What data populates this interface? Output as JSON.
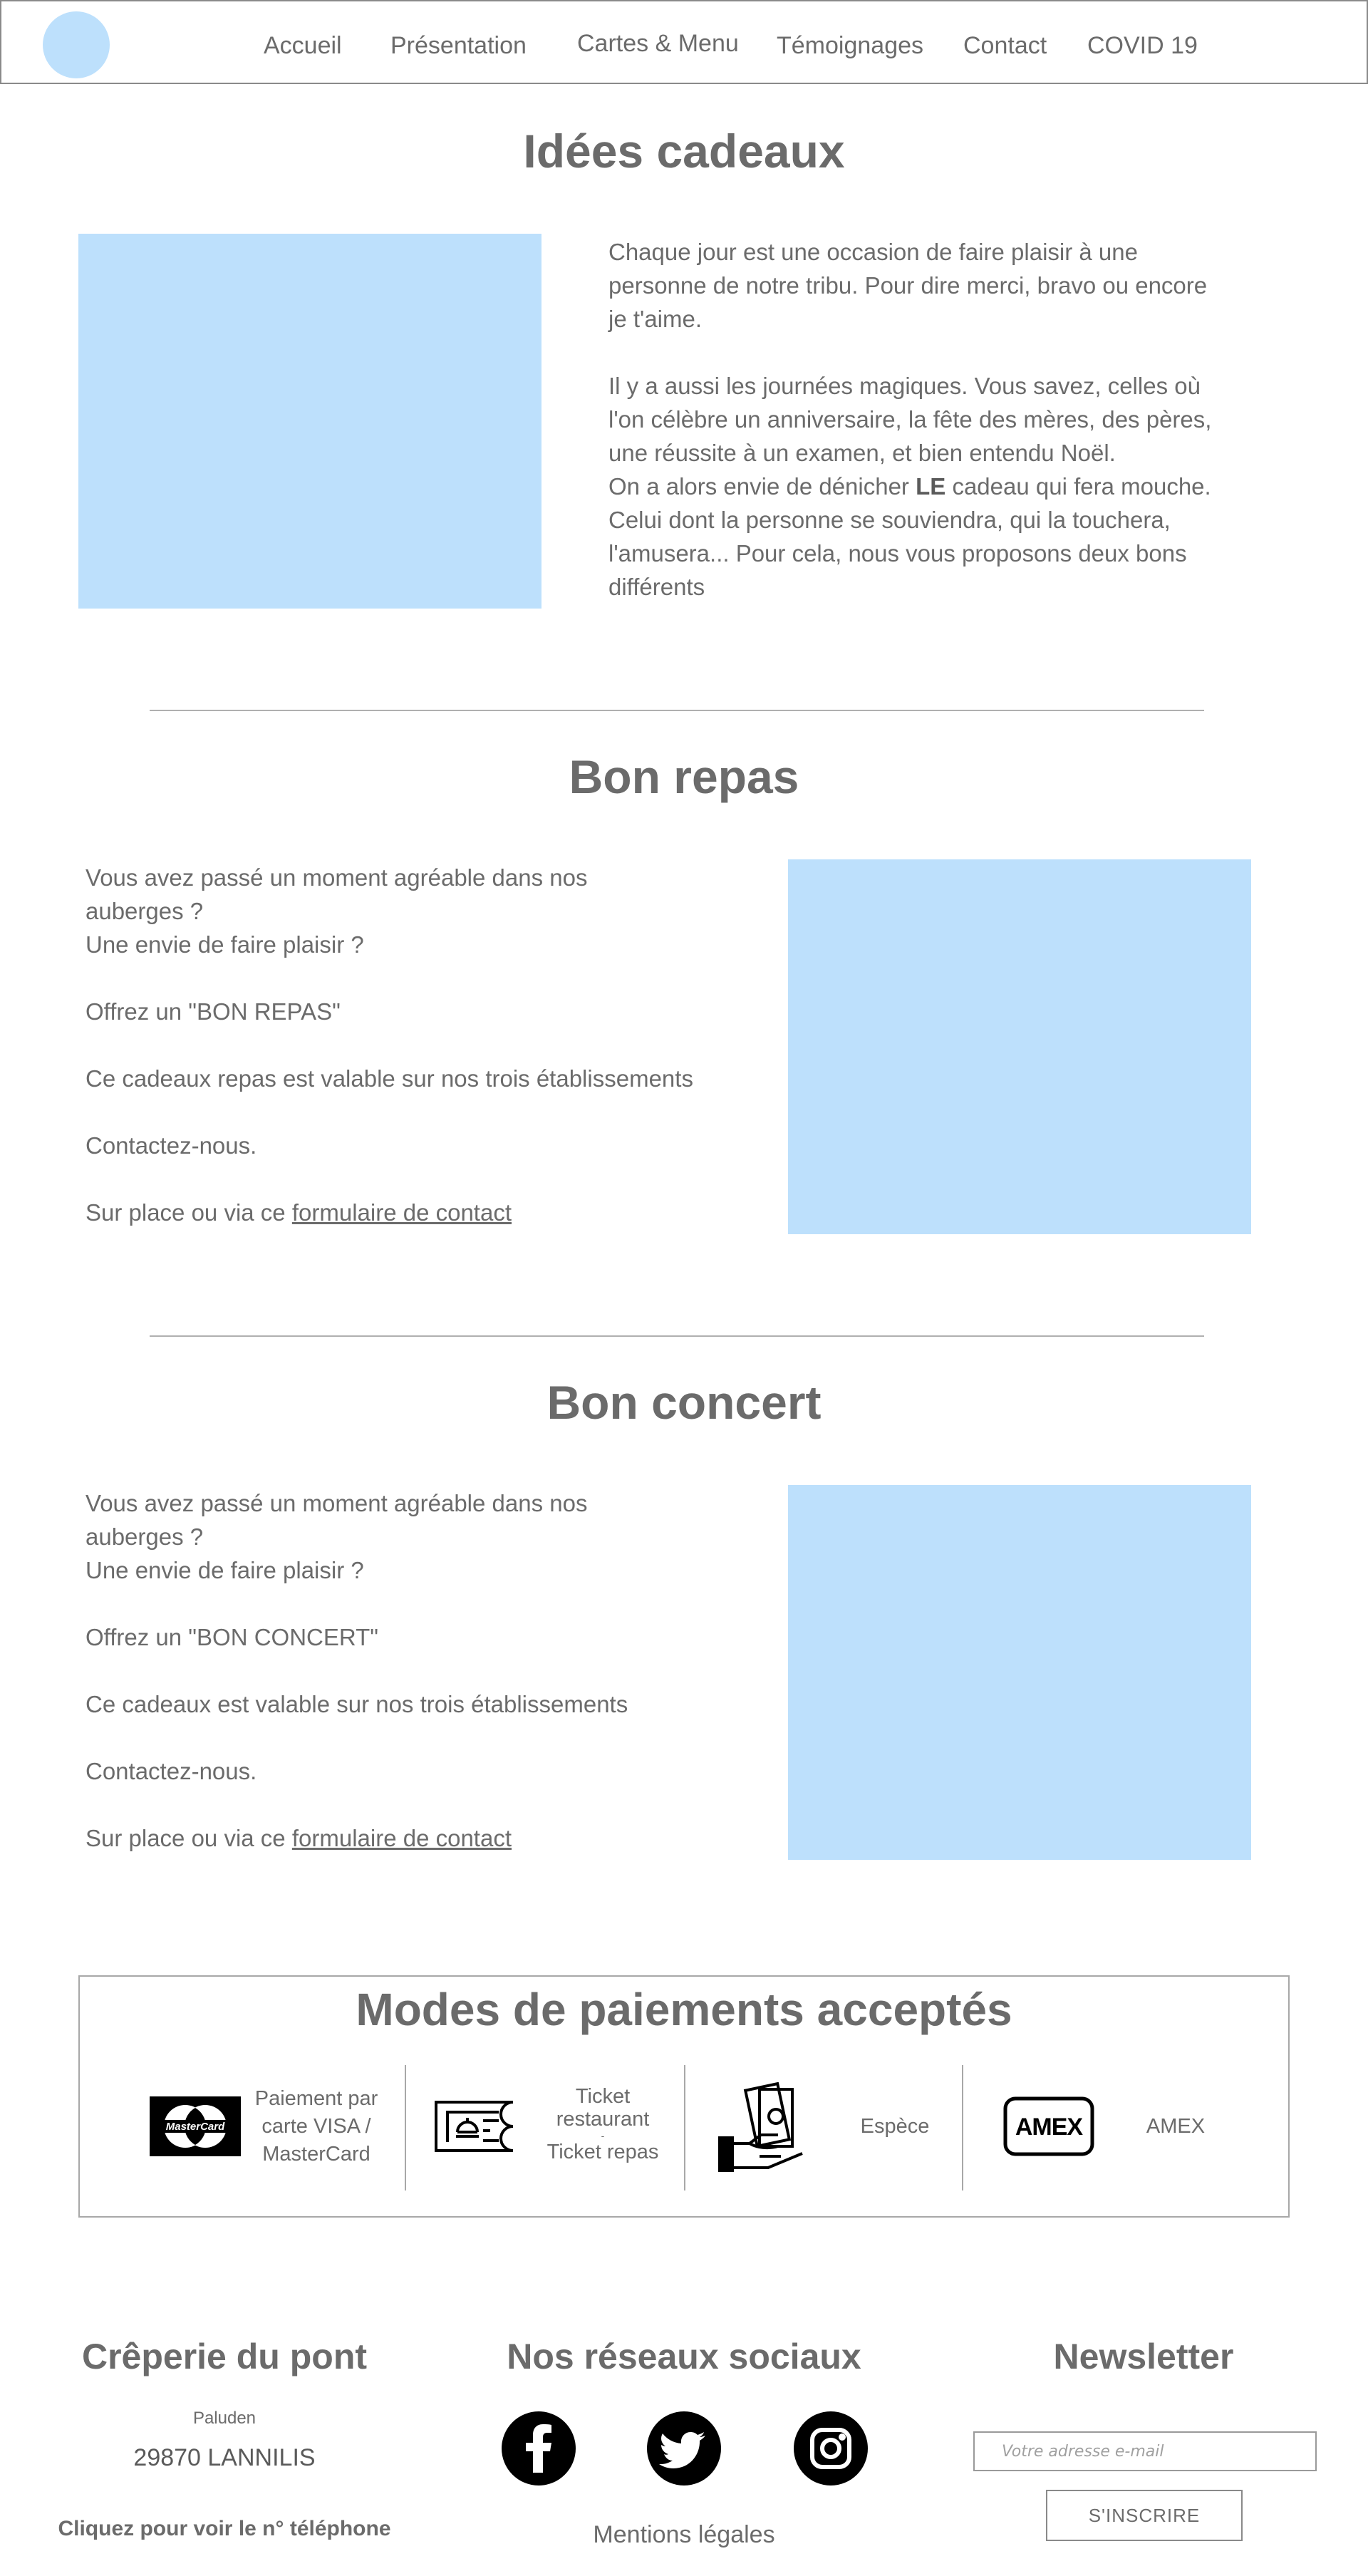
{
  "nav": {
    "items": [
      "Accueil",
      "Présentation",
      "Cartes & Menu",
      "Témoignages",
      "Contact",
      "COVID 19"
    ]
  },
  "intro": {
    "title": "Idées cadeaux",
    "p1": [
      "Chaque jour est une occasion de faire plaisir à une",
      "personne de notre tribu. Pour dire merci, bravo ou encore",
      "je t'aime."
    ],
    "p2": [
      "Il y a aussi les journées magiques. Vous savez, celles où",
      "l'on célèbre un anniversaire, la fête des mères, des pères,",
      "une réussite à un examen, et bien entendu Noël."
    ],
    "p3_before": "On a alors envie de dénicher ",
    "p3_bold": "LE",
    "p3_after": " cadeau qui fera mouche.",
    "p4": [
      "Celui dont la personne se souviendra, qui la touchera,",
      "l'amusera... Pour cela, nous vous proposons deux bons",
      "différents"
    ]
  },
  "repas": {
    "title": "Bon repas",
    "lines": [
      "Vous avez passé un moment agréable dans nos",
      "auberges ?",
      "Une envie de faire plaisir ?"
    ],
    "offer": "Offrez un \"BON REPAS\"",
    "validity": "Ce cadeaux repas est valable sur nos trois établissements",
    "contact": "Contactez-nous.",
    "via": "Sur place ou via ce ",
    "link": "formulaire de contact"
  },
  "concert": {
    "title": "Bon concert",
    "lines": [
      "Vous avez passé un moment agréable dans nos",
      "auberges ?",
      "Une envie de faire plaisir ?"
    ],
    "offer": "Offrez un \"BON CONCERT\"",
    "validity": "Ce cadeaux est valable sur nos trois établissements",
    "contact": "Contactez-nous.",
    "via": "Sur place ou via ce ",
    "link": "formulaire de contact"
  },
  "payments": {
    "title": "Modes de paiements acceptés",
    "card": {
      "line1": "Paiement par",
      "line2": "carte VISA /",
      "line3": "MasterCard",
      "icon": "mastercard-icon",
      "brand": "MasterCard"
    },
    "ticket": {
      "line1": "Ticket",
      "line2": "restaurant",
      "line3": "-",
      "line4": "Ticket repas",
      "icon": "ticket-icon"
    },
    "cash": {
      "label": "Espèce",
      "icon": "cash-icon"
    },
    "amex": {
      "label": "AMEX",
      "icon": "amex-icon",
      "brand": "AMEX"
    }
  },
  "footer": {
    "restaurant": {
      "title": "Crêperie du pont",
      "place": "Paluden",
      "city": "29870 LANNILIS",
      "phone": "Cliquez pour voir le n° téléphone"
    },
    "social": {
      "title": "Nos réseaux sociaux",
      "icons": [
        "facebook-icon",
        "twitter-icon",
        "instagram-icon"
      ],
      "legal": "Mentions légales"
    },
    "newsletter": {
      "title": "Newsletter",
      "placeholder": "Votre adresse e-mail",
      "button": "S'INSCRIRE"
    }
  },
  "colors": {
    "placeholder_blue": "#bde0fc",
    "text_gray": "#6b6b6b"
  }
}
